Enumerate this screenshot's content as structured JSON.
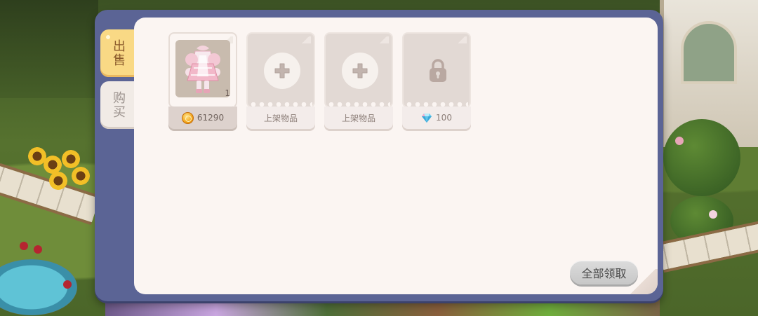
{
  "tabs": {
    "sell": "出售",
    "buy": "购买"
  },
  "slots": [
    {
      "state": "listed",
      "quantity": "1",
      "price": "61290",
      "currency_icon": "gold-coin-icon"
    },
    {
      "state": "empty",
      "label": "上架物品",
      "icon": "plus-icon"
    },
    {
      "state": "empty",
      "label": "上架物品",
      "icon": "plus-icon"
    },
    {
      "state": "locked",
      "unlock_cost": "100",
      "currency_icon": "diamond-gem-icon",
      "icon": "lock-icon"
    }
  ],
  "collect_all_label": "全部领取",
  "colors": {
    "panel": "#5b6495",
    "content": "#fbf5f2",
    "active_tab": "#f9d985",
    "inactive_tab": "#f1ebe6",
    "slot_card": "#e2d9d4"
  }
}
